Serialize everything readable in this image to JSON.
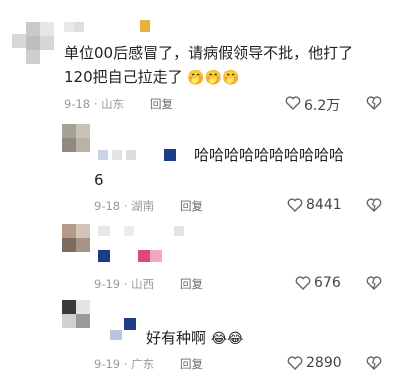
{
  "comments": [
    {
      "text_line1": "单位00后感冒了，请病假领导不批，他打了",
      "text_line2": "120把自己拉走了",
      "emoji": "🤭🤭🤭",
      "date": "9-18",
      "location": "山东",
      "reply_label": "回复",
      "likes": "6.2万"
    },
    {
      "text_line1": "哈哈哈哈哈哈哈哈哈哈",
      "text_line2": "6",
      "date": "9-18",
      "location": "湖南",
      "reply_label": "回复",
      "likes": "8441"
    },
    {
      "date": "9-19",
      "location": "山西",
      "reply_label": "回复",
      "likes": "676"
    },
    {
      "text_line1": "好有种啊",
      "emoji": "😂😂",
      "date": "9-19",
      "location": "广东",
      "reply_label": "回复",
      "likes": "2890"
    }
  ],
  "colors": {
    "emoji_pink": "#e0457b",
    "meta_gray": "#9a9a9a",
    "accent_blue": "#1f3c88",
    "accent_pink": "#e0457b",
    "accent_yellow": "#e8b23a"
  },
  "icons": {
    "like": "heart-outline-icon",
    "dislike": "broken-heart-icon"
  }
}
